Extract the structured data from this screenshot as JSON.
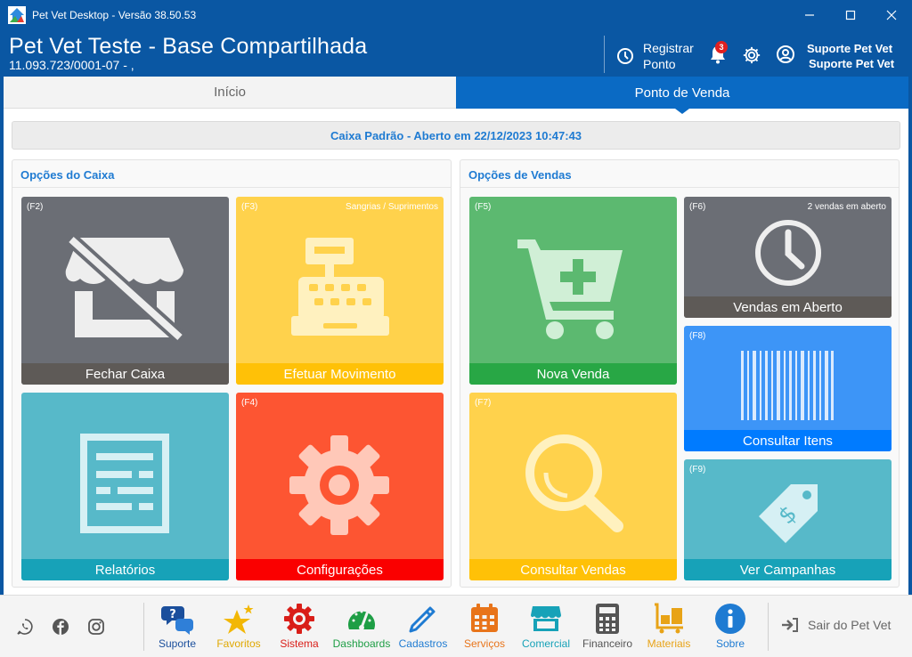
{
  "window": {
    "title": "Pet Vet Desktop - Versão 38.50.53"
  },
  "header": {
    "company_name": "Pet Vet Teste - Base Compartilhada",
    "company_sub": "11.093.723/0001-07 -  ,",
    "registrar_line1": "Registrar",
    "registrar_line2": "Ponto",
    "notifications_count": "3",
    "user_line1": "Suporte Pet Vet",
    "user_line2": "Suporte Pet Vet"
  },
  "tabs": [
    {
      "label": "Início",
      "active": false
    },
    {
      "label": "Ponto de Venda",
      "active": true
    }
  ],
  "caixa_status": "Caixa Padrão  -  Aberto em 22/12/2023 10:47:43",
  "sections": {
    "caixa": {
      "title": "Opções do Caixa",
      "tiles": [
        {
          "key": "(F2)",
          "note": "",
          "label": "Fechar Caixa",
          "icon": "closed-store-icon",
          "color": "#6b6e75",
          "bar": "#5e5a57"
        },
        {
          "key": "(F3)",
          "note": "Sangrias / Suprimentos",
          "label": "Efetuar Movimento",
          "icon": "cash-register-icon",
          "color": "#ffd24c",
          "bar": "#ffc107"
        },
        {
          "key": "",
          "note": "",
          "label": "Relatórios",
          "icon": "report-icon",
          "color": "#57b9c9",
          "bar": "#17a2b8"
        },
        {
          "key": "(F4)",
          "note": "",
          "label": "Configurações",
          "icon": "gear-icon",
          "color": "#fd5532",
          "bar": "#fa0000"
        }
      ]
    },
    "vendas": {
      "title": "Opções de Vendas",
      "tiles": [
        {
          "key": "(F5)",
          "note": "",
          "label": "Nova Venda",
          "icon": "cart-plus-icon",
          "color": "#5cb970",
          "bar": "#28a745"
        },
        {
          "key": "(F6)",
          "note": "2 vendas em aberto",
          "label": "Vendas em Aberto",
          "icon": "clock-icon",
          "color": "#6b6e75",
          "bar": "#5e5a57"
        },
        {
          "key": "(F8)",
          "note": "",
          "label": "Consultar Itens",
          "icon": "barcode-icon",
          "color": "#3d95f7",
          "bar": "#007bff"
        },
        {
          "key": "(F7)",
          "note": "",
          "label": "Consultar Vendas",
          "icon": "magnifier-icon",
          "color": "#ffd24c",
          "bar": "#ffc107"
        },
        {
          "key": "(F9)",
          "note": "",
          "label": "Ver Campanhas",
          "icon": "price-tag-icon",
          "color": "#57b9c9",
          "bar": "#17a2b8"
        }
      ]
    }
  },
  "bottom_nav": [
    {
      "label": "Suporte",
      "icon": "support-chat-icon",
      "color": "#1b4f9c"
    },
    {
      "label": "Favoritos",
      "icon": "stars-icon",
      "color": "#e0a800"
    },
    {
      "label": "Sistema",
      "icon": "system-gear-icon",
      "color": "#d91e18"
    },
    {
      "label": "Dashboards",
      "icon": "gauge-icon",
      "color": "#1e9e45"
    },
    {
      "label": "Cadastros",
      "icon": "pencil-icon",
      "color": "#1f7bd2"
    },
    {
      "label": "Serviços",
      "icon": "calendar-icon",
      "color": "#e8741a"
    },
    {
      "label": "Comercial",
      "icon": "storefront-icon",
      "color": "#17a2b8"
    },
    {
      "label": "Financeiro",
      "icon": "calculator-icon",
      "color": "#555555"
    },
    {
      "label": "Materiais",
      "icon": "pallet-icon",
      "color": "#e8a317"
    },
    {
      "label": "Sobre",
      "icon": "info-icon",
      "color": "#1f7bd2"
    }
  ],
  "exit_label": "Sair do Pet Vet"
}
